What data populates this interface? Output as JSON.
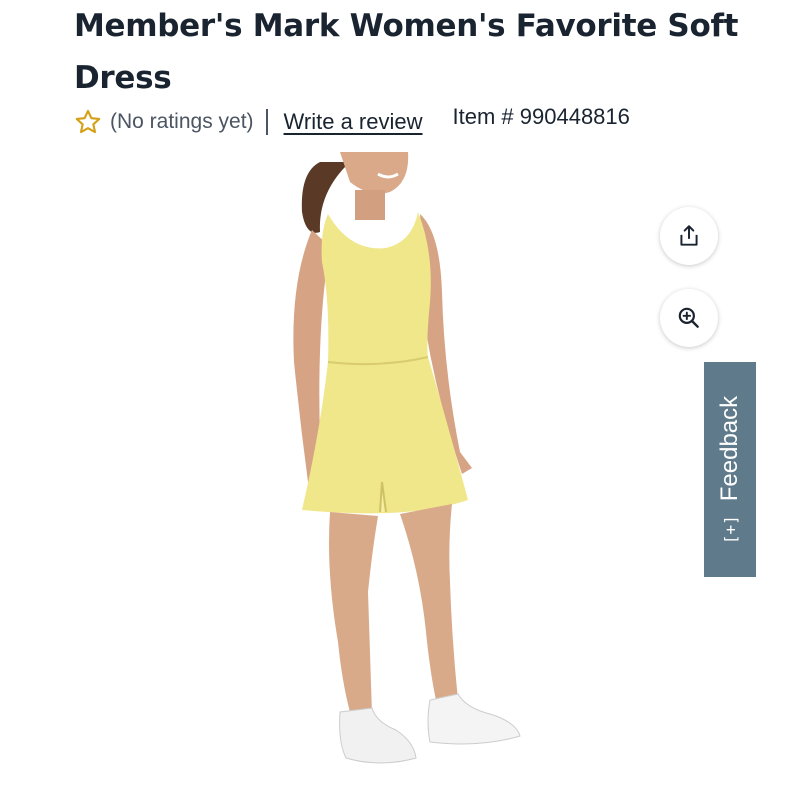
{
  "product": {
    "title_line1": "Member's Mark Women's Favorite Soft",
    "title_line2": "Dress",
    "ratings_text": "(No ratings yet)",
    "review_link": "Write a review",
    "item_number": "Item # 990448816"
  },
  "image": {
    "alt": "Model wearing yellow sleeveless dress with white sneakers",
    "dress_color": "#f0e68a"
  },
  "actions": {
    "share_icon": "share-icon",
    "zoom_icon": "zoom-in-icon"
  },
  "feedback": {
    "label": "Feedback",
    "icon_text": "[+]",
    "tab_color": "#5f7a8a"
  },
  "colors": {
    "star": "#d4a017",
    "text": "#1a2431"
  }
}
